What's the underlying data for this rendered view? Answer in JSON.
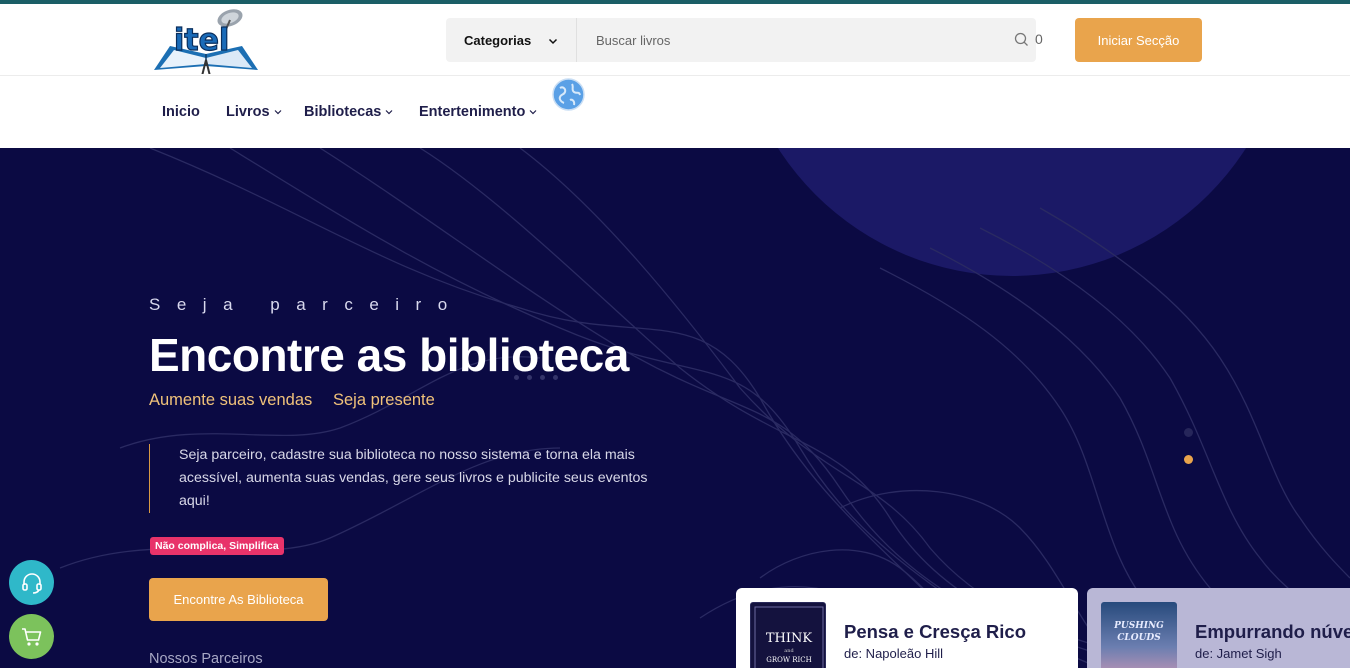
{
  "brand": {
    "logo_text": "itel"
  },
  "search": {
    "category_label": "Categorias",
    "placeholder": "Buscar livros",
    "count": "0"
  },
  "header": {
    "login_label": "Iniciar Secção"
  },
  "nav": {
    "items": [
      {
        "label": "Inicio",
        "has_dropdown": false
      },
      {
        "label": "Livros",
        "has_dropdown": true
      },
      {
        "label": "Bibliotecas",
        "has_dropdown": true
      },
      {
        "label": "Entertenimento",
        "has_dropdown": true
      }
    ],
    "globe_icon": "globe-icon"
  },
  "hero": {
    "eyebrow": "Seja parceiro",
    "title": "Encontre as biblioteca",
    "subtitle_a": "Aumente suas vendas",
    "subtitle_b": "Seja presente",
    "description": "Seja parceiro, cadastre sua biblioteca no nosso sistema e torna ela mais acessível, aumenta suas vendas, gere seus livros e publicite seus eventos aqui!",
    "badge": "Não complica, Simplifica",
    "cta_label": "Encontre As Biblioteca",
    "partners_label": "Nossos Parceiros"
  },
  "books": [
    {
      "title": "Pensa e Cresça Rico",
      "author": "de: Napoleão Hill",
      "cover_title": "THINK",
      "cover_and": "and",
      "cover_sub": "GROW RICH"
    },
    {
      "title": "Empurrando núvens",
      "author": "de: Jamet Sigh",
      "cover_title": "PUSHING",
      "cover_sub": "CLOUDS"
    }
  ],
  "colors": {
    "accent": "#e9a44c",
    "hero_bg": "#0b0a43",
    "nav_text": "#1f1e4a",
    "badge": "#e8336a"
  },
  "floating": {
    "support_icon": "headset-icon",
    "cart_icon": "cart-icon"
  }
}
